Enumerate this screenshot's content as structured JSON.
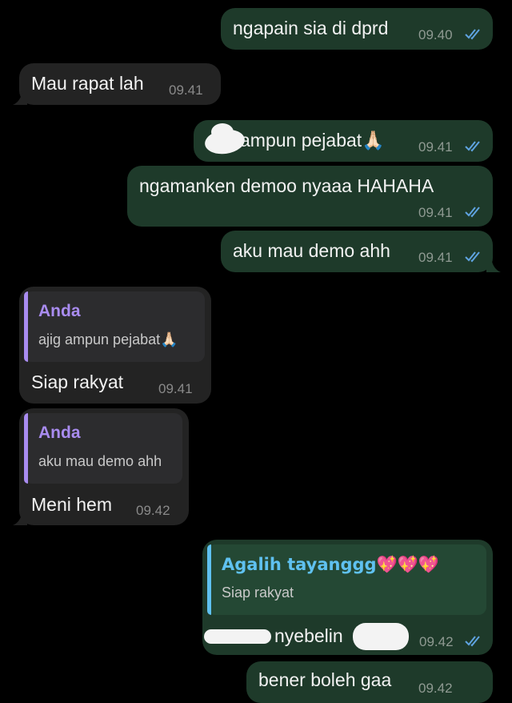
{
  "theme": {
    "outgoing_bubble": "#1e3a2a",
    "incoming_bubble": "#232323",
    "tick_color": "#5fa3e0",
    "quote_name_incoming": "#a98cf0",
    "quote_name_outgoing": "#5fc1f0"
  },
  "messages": [
    {
      "text": "ngapain sia di dprd",
      "time": "09.40",
      "icon": "double-check-icon"
    },
    {
      "text": "Mau rapat lah",
      "time": "09.41"
    },
    {
      "text": "ampun pejabat🙏🏻",
      "time": "09.41",
      "icon": "double-check-icon"
    },
    {
      "text": "ngamanken demoo nyaaa HAHAHA",
      "time": "09.41",
      "icon": "double-check-icon"
    },
    {
      "text": "aku mau demo ahh",
      "time": "09.41",
      "icon": "double-check-icon"
    },
    {
      "quote_name": "Anda",
      "quote_text": "ajig ampun pejabat🙏🏻",
      "text": "Siap rakyat",
      "time": "09.41"
    },
    {
      "quote_name": "Anda",
      "quote_text": "aku mau demo ahh",
      "text": "Meni hem",
      "time": "09.42"
    },
    {
      "quote_name": "Agalih tayanggg💖💖💖",
      "quote_text": "Siap rakyat",
      "text": "nyebelin",
      "time": "09.42",
      "icon": "double-check-icon"
    },
    {
      "text": "bener boleh gaa",
      "time": "09.42"
    }
  ]
}
